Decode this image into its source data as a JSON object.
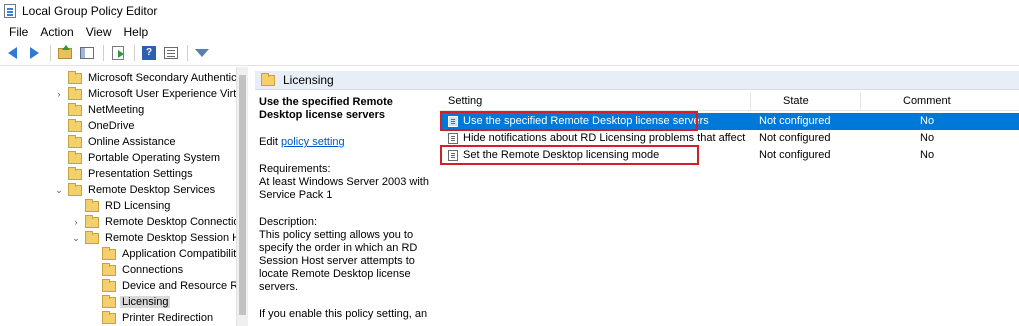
{
  "window": {
    "title": "Local Group Policy Editor"
  },
  "menu": [
    "File",
    "Action",
    "View",
    "Help"
  ],
  "toolbar": {
    "icons": [
      "back-arrow-icon",
      "forward-arrow-icon",
      "up-folder-icon",
      "show-hide-pane-icon",
      "export-list-icon",
      "help-icon",
      "properties-icon",
      "filter-icon"
    ]
  },
  "tree": {
    "items": [
      {
        "label": "Microsoft Secondary Authenticati",
        "expander": "",
        "indent": 0
      },
      {
        "label": "Microsoft User Experience Virtua",
        "expander": "›",
        "indent": 0
      },
      {
        "label": "NetMeeting",
        "expander": "",
        "indent": 0
      },
      {
        "label": "OneDrive",
        "expander": "",
        "indent": 0
      },
      {
        "label": "Online Assistance",
        "expander": "",
        "indent": 0
      },
      {
        "label": "Portable Operating System",
        "expander": "",
        "indent": 0
      },
      {
        "label": "Presentation Settings",
        "expander": "",
        "indent": 0
      },
      {
        "label": "Remote Desktop Services",
        "expander": "⌄",
        "indent": 0
      },
      {
        "label": "RD Licensing",
        "expander": "",
        "indent": 1
      },
      {
        "label": "Remote Desktop Connection",
        "expander": "›",
        "indent": 1
      },
      {
        "label": "Remote Desktop Session Ho",
        "expander": "⌄",
        "indent": 1
      },
      {
        "label": "Application Compatibilit",
        "expander": "",
        "indent": 2
      },
      {
        "label": "Connections",
        "expander": "",
        "indent": 2
      },
      {
        "label": "Device and Resource Rec",
        "expander": "",
        "indent": 2
      },
      {
        "label": "Licensing",
        "expander": "",
        "indent": 2,
        "selected": true
      },
      {
        "label": "Printer Redirection",
        "expander": "",
        "indent": 2
      }
    ]
  },
  "pane": {
    "title": "Licensing"
  },
  "description": {
    "title": "Use the specified Remote Desktop license servers",
    "edit_prefix": "Edit",
    "edit_link": "policy setting",
    "requirements_label": "Requirements:",
    "requirements_text": "At least Windows Server 2003 with Service Pack 1",
    "description_label": "Description:",
    "description_text": "This policy setting allows you to specify the order in which an RD Session Host server attempts to locate Remote Desktop license servers.",
    "enable_text": "If you enable this policy setting, an"
  },
  "list": {
    "columns": {
      "setting": "Setting",
      "state": "State",
      "comment": "Comment"
    },
    "rows": [
      {
        "setting": "Use the specified Remote Desktop license servers",
        "state": "Not configured",
        "comment": "No",
        "selected": true
      },
      {
        "setting": "Hide notifications about RD Licensing problems that affect t...",
        "state": "Not configured",
        "comment": "No"
      },
      {
        "setting": "Set the Remote Desktop licensing mode",
        "state": "Not configured",
        "comment": "No"
      }
    ]
  },
  "colors": {
    "selection": "#0078d7",
    "highlight": "#d41f2a",
    "folder": "#f3d06b",
    "link": "#0055cc"
  }
}
